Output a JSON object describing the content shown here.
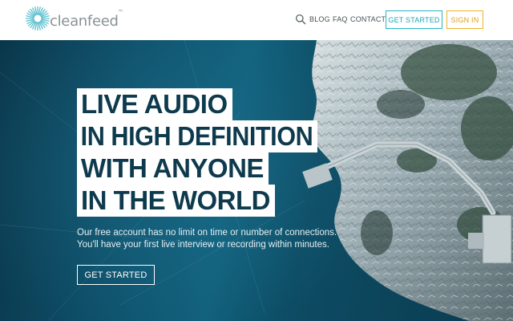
{
  "brand": {
    "name": "cleanfeed",
    "trademark": "™",
    "accent_color": "#24b6c6"
  },
  "nav": {
    "search_icon": "search-icon",
    "links": [
      "BLOG",
      "FAQ",
      "CONTACT"
    ],
    "get_started_label": "GET STARTED",
    "sign_in_label": "SIGN IN",
    "sign_in_color": "#f0b429"
  },
  "hero": {
    "headline": [
      "LIVE AUDIO",
      "IN HIGH DEFINITION",
      "WITH ANYONE",
      "IN THE WORLD"
    ],
    "subtext": [
      "Our free account has no limit on time or number of connections.",
      "You'll have your first live interview or recording within minutes."
    ],
    "cta_label": "GET STARTED"
  }
}
